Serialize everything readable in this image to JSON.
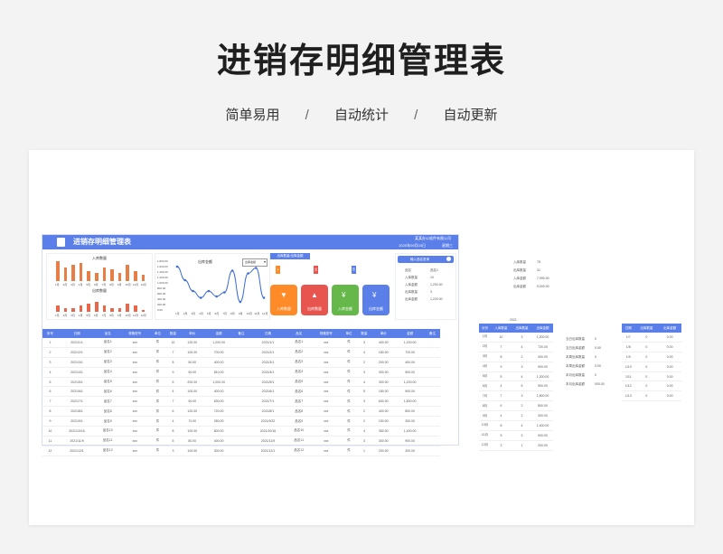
{
  "hero": {
    "title": "进销存明细管理表",
    "features": [
      "简单易用",
      "自动统计",
      "自动更新"
    ],
    "separator": "/"
  },
  "sheet": {
    "title": "进销存明细管理表",
    "company": "某某办公软件有限公司",
    "date": "2020年09月03日",
    "weekday": "星期三",
    "accent_color": "#5b7fe8"
  },
  "in_chart": {
    "title": "入库数量",
    "months": [
      "1月",
      "2月",
      "3月",
      "4月",
      "5月",
      "6月",
      "7月",
      "8月",
      "9月",
      "10月",
      "11月",
      "12月"
    ],
    "values": [
      10,
      7,
      8,
      9,
      5,
      4,
      7,
      6,
      4,
      8,
      5,
      3
    ]
  },
  "out_chart": {
    "title": "出库数量",
    "values": [
      3,
      2,
      2,
      3,
      4,
      5,
      3,
      2,
      2,
      4,
      3,
      1
    ]
  },
  "line_chart": {
    "title": "出库金额",
    "dropdown": "出库金额",
    "yticks": [
      "1,800.00",
      "1,600.00",
      "1,400.00",
      "1,200.00",
      "1,000.00",
      "800.00",
      "600.00",
      "400.00",
      "200.00",
      "0.00"
    ],
    "months": [
      "1月",
      "2月",
      "3月",
      "4月",
      "5月",
      "6月",
      "7月",
      "8月",
      "9月",
      "10月",
      "11月",
      "12月"
    ],
    "values": [
      1600,
      1100,
      700,
      450,
      700,
      500,
      650,
      1450,
      300,
      1350,
      1550,
      450
    ]
  },
  "actions": {
    "header": "出库数量/出库金额",
    "tags": [
      "入库",
      "出库",
      "查询"
    ],
    "buttons": [
      {
        "label": "入库数量",
        "icon": "▼",
        "color": "#ff8a28"
      },
      {
        "label": "出库数量",
        "icon": "▲",
        "color": "#e8554e"
      },
      {
        "label": "入库金额",
        "icon": "¥",
        "color": "#66b84a"
      },
      {
        "label": "出库金额",
        "icon": "¥",
        "color": "#5b7fe8"
      }
    ]
  },
  "query": {
    "header": "输入品名查询",
    "rows": [
      {
        "k": "品名",
        "v": "品名1"
      },
      {
        "k": "入库数量",
        "v": "10"
      },
      {
        "k": "入库金额",
        "v": "1,200.00"
      },
      {
        "k": "出库数量",
        "v": "3"
      },
      {
        "k": "出库金额",
        "v": "1,220.00"
      }
    ]
  },
  "table": {
    "headers": [
      "序号",
      "日期",
      "品名",
      "规格型号",
      "单位",
      "数量",
      "单价",
      "金额",
      "备注",
      "日期",
      "品名",
      "规格型号",
      "单位",
      "数量",
      "单价",
      "金额",
      "备注"
    ],
    "rows": [
      [
        "1",
        "2021/1/1",
        "品名1",
        "xxx",
        "件",
        "10",
        "120.00",
        "1,200.00",
        "",
        "2021/1/1",
        "品名1",
        "xxx",
        "件",
        "3",
        "400.00",
        "1,200.00",
        ""
      ],
      [
        "2",
        "2021/2/1",
        "品名2",
        "xxx",
        "件",
        "7",
        "100.00",
        "700.00",
        "",
        "2021/2/1",
        "品名2",
        "xxx",
        "件",
        "4",
        "180.00",
        "720.00",
        ""
      ],
      [
        "3",
        "2021/3/1",
        "品名3",
        "xxx",
        "件",
        "8",
        "50.00",
        "400.00",
        "",
        "2021/3/1",
        "品名3",
        "xxx",
        "件",
        "2",
        "200.00",
        "400.00",
        ""
      ],
      [
        "4",
        "2021/4/1",
        "品名4",
        "xxx",
        "件",
        "9",
        "90.00",
        "810.00",
        "",
        "2021/4/1",
        "品名4",
        "xxx",
        "件",
        "3",
        "300.00",
        "900.00",
        ""
      ],
      [
        "5",
        "2021/5/1",
        "品名5",
        "xxx",
        "件",
        "5",
        "200.00",
        "1,000.00",
        "",
        "2021/5/1",
        "品名5",
        "xxx",
        "件",
        "4",
        "300.00",
        "1,200.00",
        ""
      ],
      [
        "6",
        "2021/6/1",
        "品名6",
        "xxx",
        "件",
        "4",
        "100.00",
        "400.00",
        "",
        "2021/6/1",
        "品名6",
        "xxx",
        "件",
        "5",
        "180.00",
        "900.00",
        ""
      ],
      [
        "7",
        "2021/7/1",
        "品名7",
        "xxx",
        "件",
        "7",
        "90.00",
        "630.00",
        "",
        "2021/7/1",
        "品名7",
        "xxx",
        "件",
        "3",
        "600.00",
        "1,800.00",
        ""
      ],
      [
        "8",
        "2021/8/1",
        "品名8",
        "xxx",
        "件",
        "6",
        "120.00",
        "720.00",
        "",
        "2021/8/1",
        "品名8",
        "xxx",
        "件",
        "2",
        "400.00",
        "800.00",
        ""
      ],
      [
        "9",
        "2021/9/1",
        "品名9",
        "xxx",
        "件",
        "4",
        "70.00",
        "280.00",
        "",
        "2021/9/22",
        "品名9",
        "xxx",
        "件",
        "2",
        "150.00",
        "300.00",
        ""
      ],
      [
        "10",
        "2021/10/16",
        "品名10",
        "xxx",
        "件",
        "8",
        "100.00",
        "800.00",
        "",
        "2021/10/16",
        "品名10",
        "xxx",
        "件",
        "4",
        "350.00",
        "1,400.00",
        ""
      ],
      [
        "11",
        "2021/11/9",
        "品名11",
        "xxx",
        "件",
        "5",
        "80.00",
        "400.00",
        "",
        "2021/11/9",
        "品名11",
        "xxx",
        "件",
        "3",
        "300.00",
        "900.00",
        ""
      ],
      [
        "12",
        "2021/12/1",
        "品名12",
        "xxx",
        "件",
        "3",
        "100.00",
        "300.00",
        "",
        "2021/12/1",
        "品名12",
        "xxx",
        "件",
        "1",
        "200.00",
        "200.00",
        ""
      ]
    ]
  },
  "side": {
    "summary": [
      {
        "k": "入库数量",
        "v": "78"
      },
      {
        "k": "出库数量",
        "v": "31"
      },
      {
        "k": "入库金额",
        "v": "7,990.00"
      },
      {
        "k": "出库金额",
        "v": "9,000.00"
      }
    ],
    "year": "2021",
    "monthly_headers": [
      "月份",
      "入库数量",
      "出库数量",
      "出库金额"
    ],
    "monthly": [
      [
        "1月",
        "10",
        "3",
        "1,200.00"
      ],
      [
        "2月",
        "7",
        "4",
        "720.00"
      ],
      [
        "3月",
        "8",
        "2",
        "400.00"
      ],
      [
        "4月",
        "9",
        "3",
        "900.00"
      ],
      [
        "5月",
        "5",
        "4",
        "1,200.00"
      ],
      [
        "6月",
        "4",
        "5",
        "900.00"
      ],
      [
        "7月",
        "7",
        "3",
        "1,800.00"
      ],
      [
        "8月",
        "6",
        "2",
        "800.00"
      ],
      [
        "9月",
        "4",
        "2",
        "300.00"
      ],
      [
        "10月",
        "8",
        "4",
        "1,400.00"
      ],
      [
        "11月",
        "5",
        "3",
        "900.00"
      ],
      [
        "12月",
        "3",
        "1",
        "200.00"
      ]
    ],
    "labels": [
      {
        "k": "当日出库数量",
        "v": "0"
      },
      {
        "k": "当日出库金额",
        "v": "0.00"
      },
      {
        "k": "本周出库数量",
        "v": "0"
      },
      {
        "k": "本周出库金额",
        "v": "0.00"
      },
      {
        "k": "本月出库数量",
        "v": "0"
      },
      {
        "k": "本月出库金额",
        "v": "000.00"
      }
    ],
    "daily_headers": [
      "日期",
      "出库数量",
      "出库金额"
    ],
    "daily": [
      [
        "1/7",
        "0",
        "0.00"
      ],
      [
        "1/8",
        "0",
        "0.00"
      ],
      [
        "1/9",
        "0",
        "0.00"
      ],
      [
        "1/10",
        "0",
        "0.00"
      ],
      [
        "1/11",
        "0",
        "0.00"
      ],
      [
        "1/12",
        "0",
        "0.00"
      ],
      [
        "1/13",
        "0",
        "0.00"
      ]
    ]
  }
}
